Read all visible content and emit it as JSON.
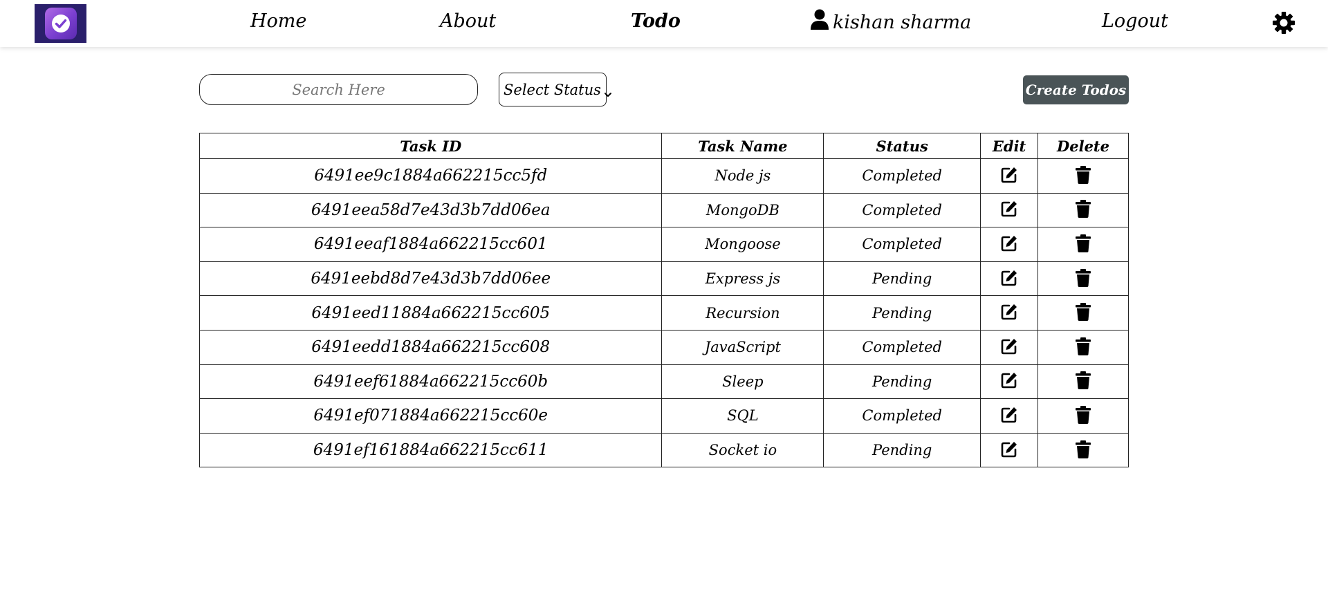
{
  "nav": {
    "home": "Home",
    "about": "About",
    "todo": "Todo",
    "user": "kishan sharma",
    "logout": "Logout"
  },
  "toolbar": {
    "search_placeholder": "Search Here",
    "status_select": "Select Status",
    "create_label": "Create Todos"
  },
  "table": {
    "headers": {
      "task_id": "Task ID",
      "task_name": "Task Name",
      "status": "Status",
      "edit": "Edit",
      "delete": "Delete"
    },
    "rows": [
      {
        "id": "6491ee9c1884a662215cc5fd",
        "name": "Node js",
        "status": "Completed"
      },
      {
        "id": "6491eea58d7e43d3b7dd06ea",
        "name": "MongoDB",
        "status": "Completed"
      },
      {
        "id": "6491eeaf1884a662215cc601",
        "name": "Mongoose",
        "status": "Completed"
      },
      {
        "id": "6491eebd8d7e43d3b7dd06ee",
        "name": "Express js",
        "status": "Pending"
      },
      {
        "id": "6491eed11884a662215cc605",
        "name": "Recursion",
        "status": "Pending"
      },
      {
        "id": "6491eedd1884a662215cc608",
        "name": "JavaScript",
        "status": "Completed"
      },
      {
        "id": "6491eef61884a662215cc60b",
        "name": "Sleep",
        "status": "Pending"
      },
      {
        "id": "6491ef071884a662215cc60e",
        "name": "SQL",
        "status": "Completed"
      },
      {
        "id": "6491ef161884a662215cc611",
        "name": "Socket io",
        "status": "Pending"
      }
    ]
  },
  "icons": {
    "logo": "checkmark-logo-icon",
    "user": "user-icon",
    "theme": "gear-icon",
    "chevron": "chevron-down-icon",
    "edit": "edit-icon",
    "delete": "trash-icon"
  },
  "colors": {
    "logo_bg": "#2a1f6b",
    "logo_gradient": "#8a4ad8",
    "create_button": "#4a5457"
  }
}
